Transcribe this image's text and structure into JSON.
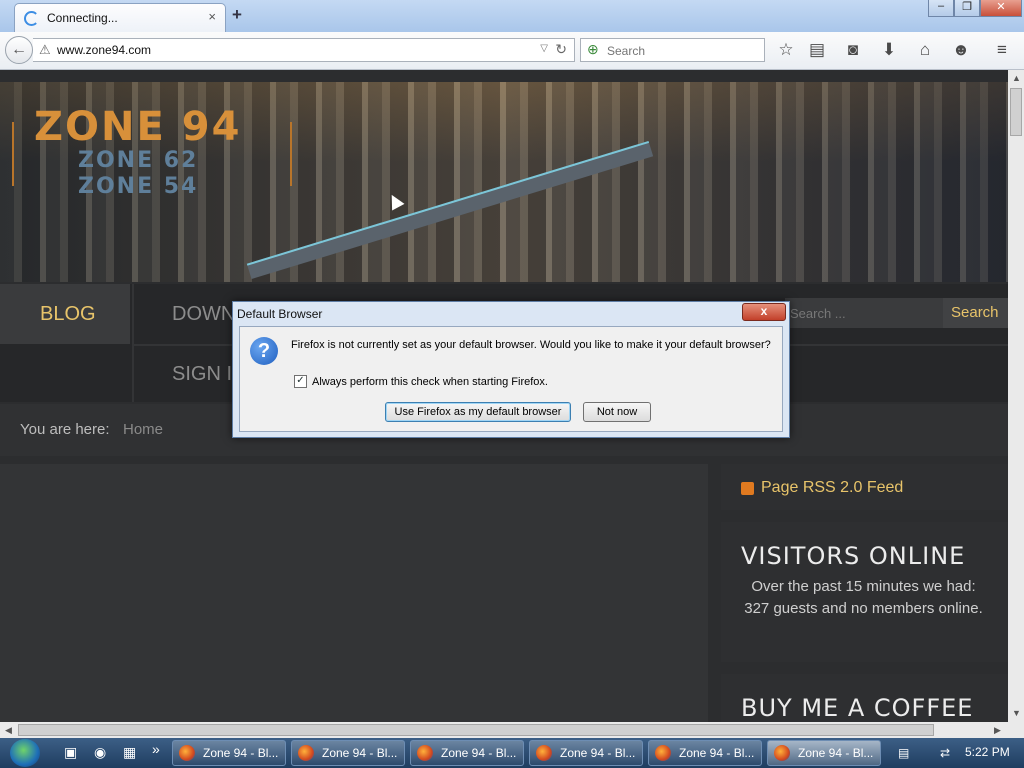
{
  "browser": {
    "tab_title": "Connecting...",
    "tab_close": "×",
    "new_tab": "+",
    "url": "www.zone94.com",
    "search_placeholder": "Search",
    "window_buttons": [
      "–",
      "❐",
      "✕"
    ],
    "tool_icons": [
      "bookmark-star-icon",
      "reading-list-icon",
      "pocket-icon",
      "download-icon",
      "home-icon",
      "hello-icon",
      "menu-icon"
    ]
  },
  "site": {
    "logo_main": "ZONE 94",
    "logo_sub1": "ZONE 62",
    "logo_sub2": "ZONE 54",
    "menu": {
      "blog": "BLOG",
      "downloads": "DOWN",
      "sign_in": "SIGN I",
      "search_placeholder": "Search ...",
      "search_button": "Search"
    },
    "breadcrumb": {
      "label": "You are here:",
      "home": "Home"
    },
    "sidebar": {
      "rss": "Page RSS 2.0 Feed",
      "visitors_title": "VISITORS ONLINE",
      "visitors_text": "Over the past 15 minutes we had: 327 guests and no members online.",
      "coffee_title": "BUY ME A COFFEE"
    }
  },
  "dialog": {
    "title": "Default Browser",
    "close": "x",
    "message": "Firefox is not currently set as your default browser. Would you like to make it your default browser?",
    "checkbox_checked": true,
    "checkbox_mark": "✓",
    "checkbox_label": "Always perform this check when starting Firefox.",
    "primary_button": "Use Firefox as my default browser",
    "secondary_button": "Not now"
  },
  "taskbar": {
    "tasks": [
      "Zone 94 - Bl...",
      "Zone 94 - Bl...",
      "Zone 94 - Bl...",
      "Zone 94 - Bl...",
      "Zone 94 - Bl...",
      "Zone 94 - Bl..."
    ],
    "active_index": 5,
    "quicklaunch_overflow": "»",
    "clock": "5:22 PM"
  }
}
